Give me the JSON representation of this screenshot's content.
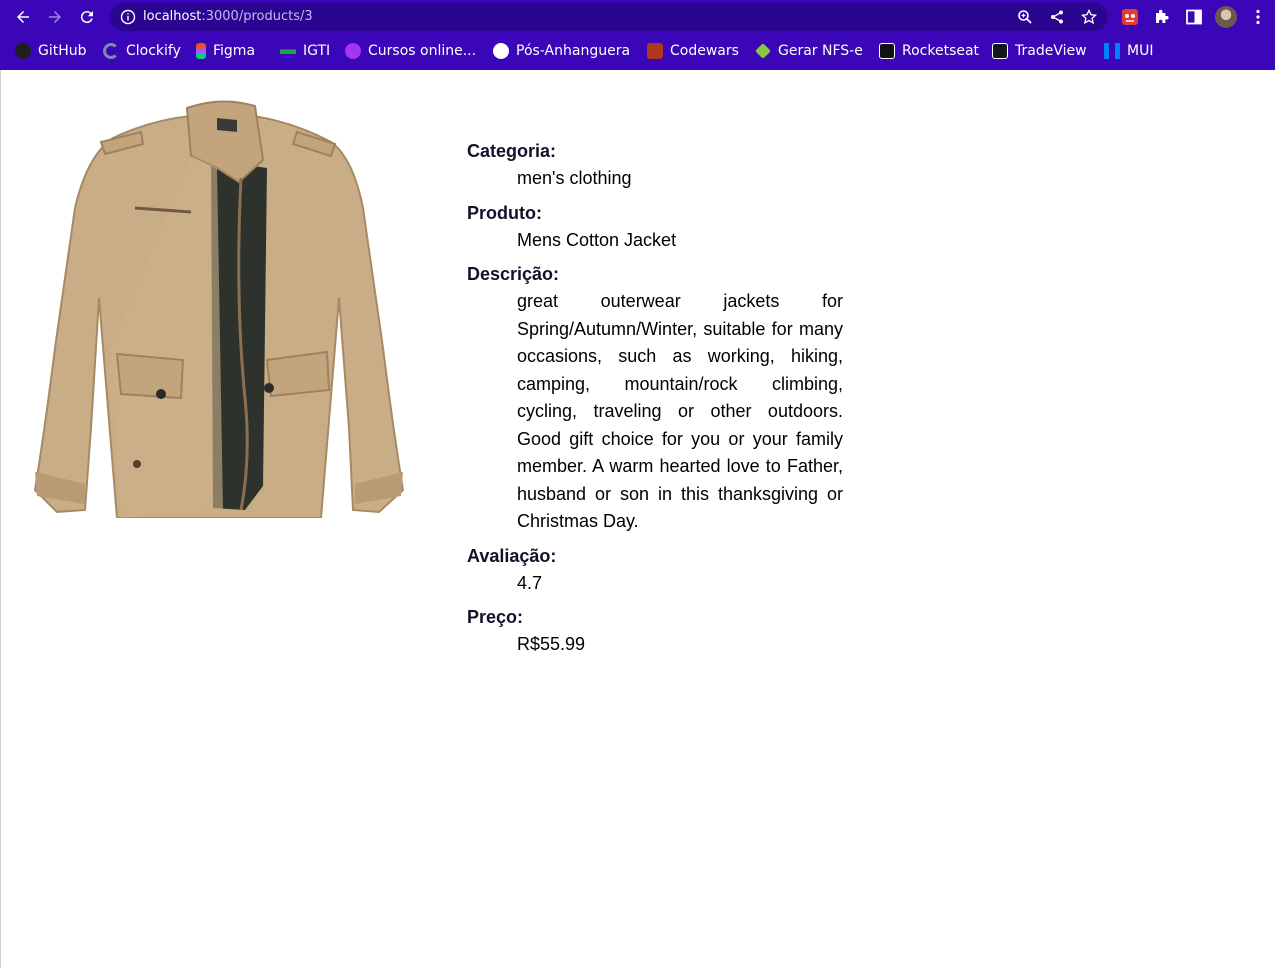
{
  "browser": {
    "url_host": "localhost",
    "url_path": ":3000/products/3",
    "bookmarks": [
      {
        "label": "GitHub",
        "icon": "github-icon",
        "color": "#1f1f1f"
      },
      {
        "label": "Clockify",
        "icon": "clockify-icon",
        "color": "#7f8aa6"
      },
      {
        "label": "Figma",
        "icon": "figma-icon",
        "color": "#f24e1e"
      },
      {
        "label": "IGTI",
        "icon": "igti-icon",
        "color": "#22a04a"
      },
      {
        "label": "Cursos online...",
        "icon": "udemy-icon",
        "color": "#a435f0"
      },
      {
        "label": "Pós-Anhanguera",
        "icon": "globe-icon",
        "color": "#ffffff"
      },
      {
        "label": "Codewars",
        "icon": "codewars-icon",
        "color": "#b1361e"
      },
      {
        "label": "Gerar NFS-e",
        "icon": "nfse-icon",
        "color": "#8cc63f"
      },
      {
        "label": "Rocketseat",
        "icon": "rocketseat-icon",
        "color": "#121214"
      },
      {
        "label": "TradeView",
        "icon": "tradingview-icon",
        "color": "#131722"
      },
      {
        "label": "MUI",
        "icon": "mui-icon",
        "color": "#007fff"
      }
    ]
  },
  "product": {
    "image_alt": "Mens Cotton Jacket",
    "category_label": "Categoria:",
    "category": "men's clothing",
    "name_label": "Produto:",
    "name": "Mens Cotton Jacket",
    "description_label": "Descrição:",
    "description": "great outerwear jackets for Spring/Autumn/Winter, suitable for many occasions, such as working, hiking, camping, mountain/rock climbing, cycling, traveling or other outdoors. Good gift choice for you or your family member. A warm hearted love to Father, husband or son in this thanksgiving or Christmas Day.",
    "rating_label": "Avaliação:",
    "rating": "4.7",
    "price_label": "Preço:",
    "price": "R$55.99"
  },
  "colors": {
    "chrome": "#3a06b8",
    "omnibox": "#2a0590",
    "jacket": "#c9ad86"
  }
}
